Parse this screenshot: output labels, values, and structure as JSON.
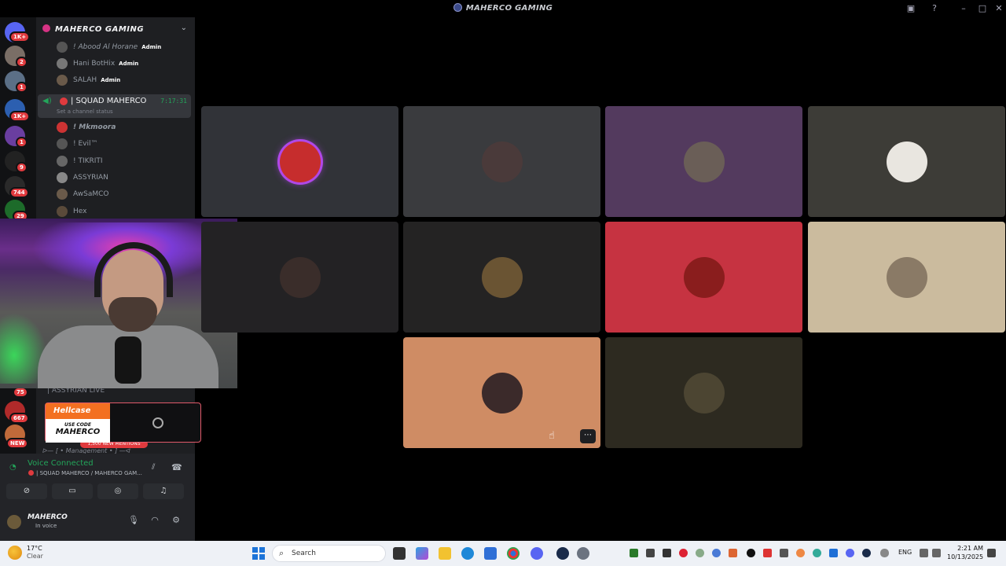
{
  "window": {
    "title": "MAHERCO GAMING"
  },
  "rail": {
    "badges": [
      "1K+",
      "2",
      "1",
      "1K+",
      "1",
      "9",
      "744",
      "29",
      "75",
      "667",
      "NEW"
    ]
  },
  "sidebar": {
    "server_name": "MAHERCO GAMING",
    "members_top": [
      {
        "name": "! Abood Al Horane",
        "tag": "Admin"
      },
      {
        "name": "Hani BotHix",
        "tag": "Admin"
      },
      {
        "name": "SALAH",
        "tag": "Admin"
      }
    ],
    "channel": {
      "name": "| SQUAD MAHERCO",
      "timer": "7:17:31",
      "status": "Set a channel status"
    },
    "members": [
      {
        "name": "! Mkmoora"
      },
      {
        "name": "! Evil™"
      },
      {
        "name": "! TIKRITI"
      },
      {
        "name": "ASSYRIAN"
      },
      {
        "name": "AwSaMCO"
      },
      {
        "name": "Hex"
      }
    ],
    "lower_channel": "| ASSYRIAN LIVE",
    "mentions": "1,500 NEW MENTIONS",
    "category": "ᐅ— [ • Management • ] —ᐊ"
  },
  "promo": {
    "brand": "Hellcase",
    "code_label": "USE CODE",
    "code": "MAHERCO"
  },
  "voice": {
    "status": "Voice Connected",
    "channel": "| SQUAD MAHERCO / MAHERCO GAM...",
    "user_name": "MAHERCO",
    "user_status": "In voice"
  },
  "tiles": [
    {
      "bg": "#313338",
      "avatar": "#c62d2d",
      "ring": "#b048e8"
    },
    {
      "bg": "#3a3b3e",
      "avatar": "#4a3a3a"
    },
    {
      "bg": "#533a5e",
      "avatar": "#6a5e57"
    },
    {
      "bg": "#3d3c37",
      "avatar": "#e9e6e0"
    },
    {
      "bg": "#232224",
      "avatar": "#3a2d2a"
    },
    {
      "bg": "#242323",
      "avatar": "#6a5433"
    },
    {
      "bg": "#c63341",
      "avatar": "#8a1d1d"
    },
    {
      "bg": "#cbbb9e",
      "avatar": "#8a7a66"
    },
    {
      "bg": "#cf8c64",
      "avatar": "#3b2a2a"
    },
    {
      "bg": "#2d2a20",
      "avatar": "#4c4532"
    }
  ],
  "taskbar": {
    "temp": "17°C",
    "weather": "Clear",
    "search_placeholder": "Search",
    "lang": "ENG",
    "time": "2:21 AM",
    "date": "10/13/2025"
  }
}
